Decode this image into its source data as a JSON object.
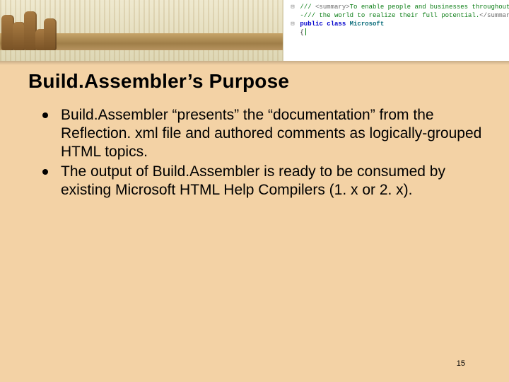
{
  "banner": {
    "code_lines": [
      {
        "gutter": "⊟",
        "prefix_kw": "",
        "segments": [
          {
            "cls": "cmt",
            "t": "/// "
          },
          {
            "cls": "tag",
            "t": "<summary>"
          },
          {
            "cls": "cmt",
            "t": "To enable people and businesses throughout"
          }
        ]
      },
      {
        "gutter": "",
        "prefix_kw": "",
        "segments": [
          {
            "cls": "cmt",
            "t": "-/// the world to realize their full potential."
          },
          {
            "cls": "tag",
            "t": "</summary>"
          }
        ]
      },
      {
        "gutter": "⊟",
        "prefix_kw": "",
        "segments": [
          {
            "cls": "kw",
            "t": "public class "
          },
          {
            "cls": "typ",
            "t": "Microsoft"
          }
        ]
      },
      {
        "gutter": "",
        "prefix_kw": "",
        "segments": [
          {
            "cls": "",
            "t": "{"
          }
        ]
      }
    ]
  },
  "title": "Build.Assembler’s Purpose",
  "bullets": [
    "Build.Assembler “presents” the “documentation” from the Reflection. xml file and authored comments as logically-grouped HTML topics.",
    "The output of Build.Assembler is ready to be consumed by existing Microsoft HTML Help Compilers (1. x or 2. x)."
  ],
  "page_number": "15"
}
